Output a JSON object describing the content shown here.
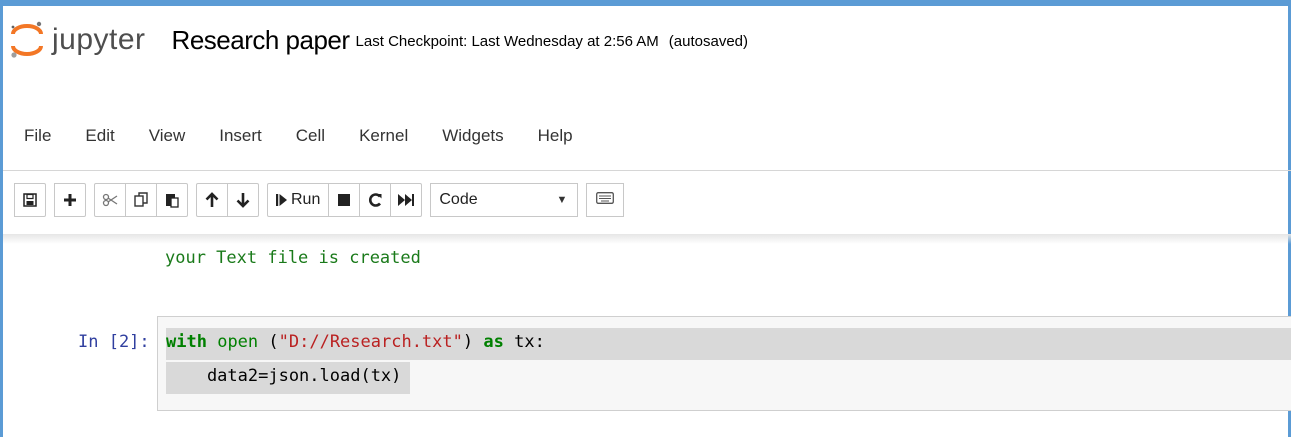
{
  "header": {
    "logo_text": "jupyter",
    "notebook_name": "Research paper",
    "checkpoint": "Last Checkpoint: Last Wednesday at 2:56 AM",
    "autosave_status": "(autosaved)"
  },
  "menu": {
    "items": [
      "File",
      "Edit",
      "View",
      "Insert",
      "Cell",
      "Kernel",
      "Widgets",
      "Help"
    ]
  },
  "toolbar": {
    "run_label": "Run",
    "cell_type": "Code",
    "icons": [
      "save-icon",
      "plus-icon",
      "cut-icon",
      "copy-icon",
      "paste-icon",
      "arrow-up-icon",
      "arrow-down-icon",
      "run-icon",
      "stop-icon",
      "restart-icon",
      "fast-forward-icon",
      "keyboard-icon"
    ]
  },
  "notebook": {
    "previous_output": "your Text file is created",
    "cell_prompt": "In [2]:",
    "code": {
      "line1": {
        "kw_with": "with",
        "fn_open": "open",
        "str_arg": "\"D://Research.txt\"",
        "kw_as": "as",
        "var": "tx:"
      },
      "line2": "    data2=json.load(tx)"
    }
  },
  "colors": {
    "frame": "#5b9bd5",
    "keyword": "#008000",
    "string": "#ba2121",
    "prompt": "#303f9f",
    "output": "#1a7a1a"
  }
}
